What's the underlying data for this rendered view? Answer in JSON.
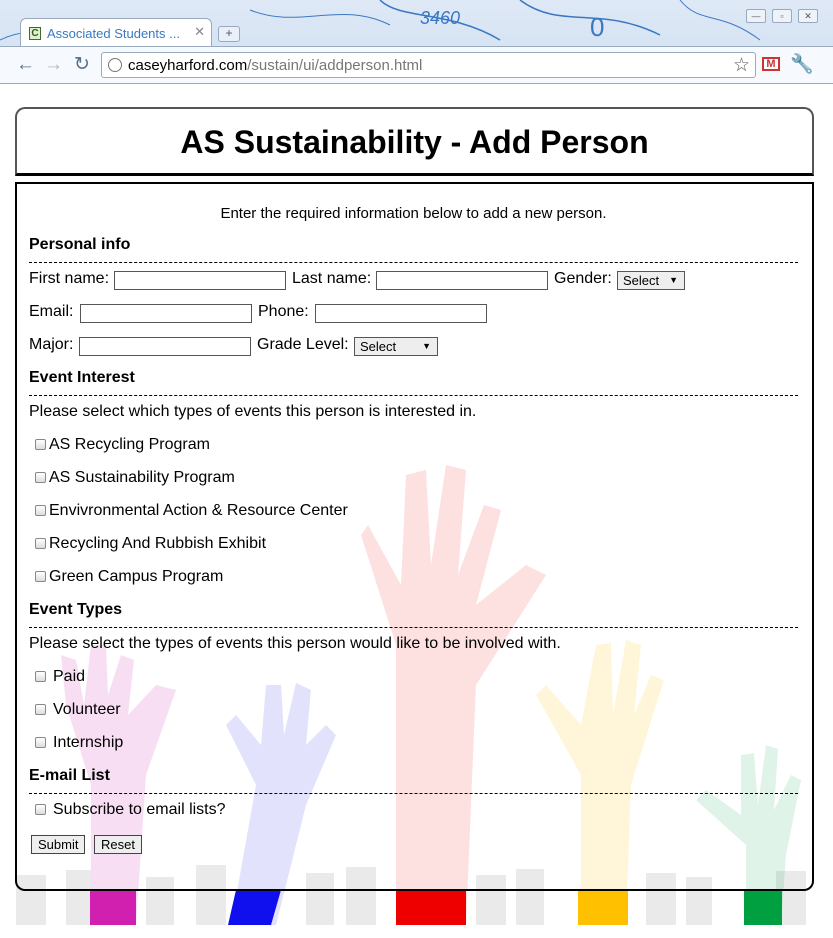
{
  "browser": {
    "tab_title": "Associated Students ...",
    "tab_favicon": "C",
    "url_host": "caseyharford.com",
    "url_path": "/sustain/ui/addperson.html",
    "icons": [
      "back-icon",
      "forward-icon",
      "reload-icon",
      "globe-icon",
      "star-icon",
      "gmail-icon",
      "wrench-icon"
    ]
  },
  "header": {
    "title": "AS Sustainability - Add Person"
  },
  "intro": "Enter the required information below to add a new person.",
  "personal": {
    "heading": "Personal info",
    "first_name_label": "First name:",
    "last_name_label": "Last name:",
    "gender_label": "Gender:",
    "gender_selected": "Select",
    "email_label": "Email:",
    "phone_label": "Phone:",
    "major_label": "Major:",
    "grade_label": "Grade Level:",
    "grade_selected": "Select"
  },
  "event_interest": {
    "heading": "Event Interest",
    "description": "Please select which types of events this person is interested in.",
    "options": [
      "AS Recycling Program",
      "AS Sustainability Program",
      "Envivronmental Action & Resource Center",
      "Recycling And Rubbish Exhibit",
      "Green Campus Program"
    ]
  },
  "event_types": {
    "heading": "Event Types",
    "description": "Please select the types of events this person would like to be involved with.",
    "options": [
      "Paid",
      "Volunteer",
      "Internship"
    ]
  },
  "email_list": {
    "heading": "E-mail List",
    "subscribe_label": "Subscribe to email lists?"
  },
  "buttons": {
    "submit": "Submit",
    "reset": "Reset"
  },
  "colors": {
    "hand_pink": "#d11fb0",
    "hand_blue": "#1010ee",
    "hand_red": "#ee0000",
    "hand_yellow": "#ffc000",
    "hand_green": "#00a040"
  }
}
